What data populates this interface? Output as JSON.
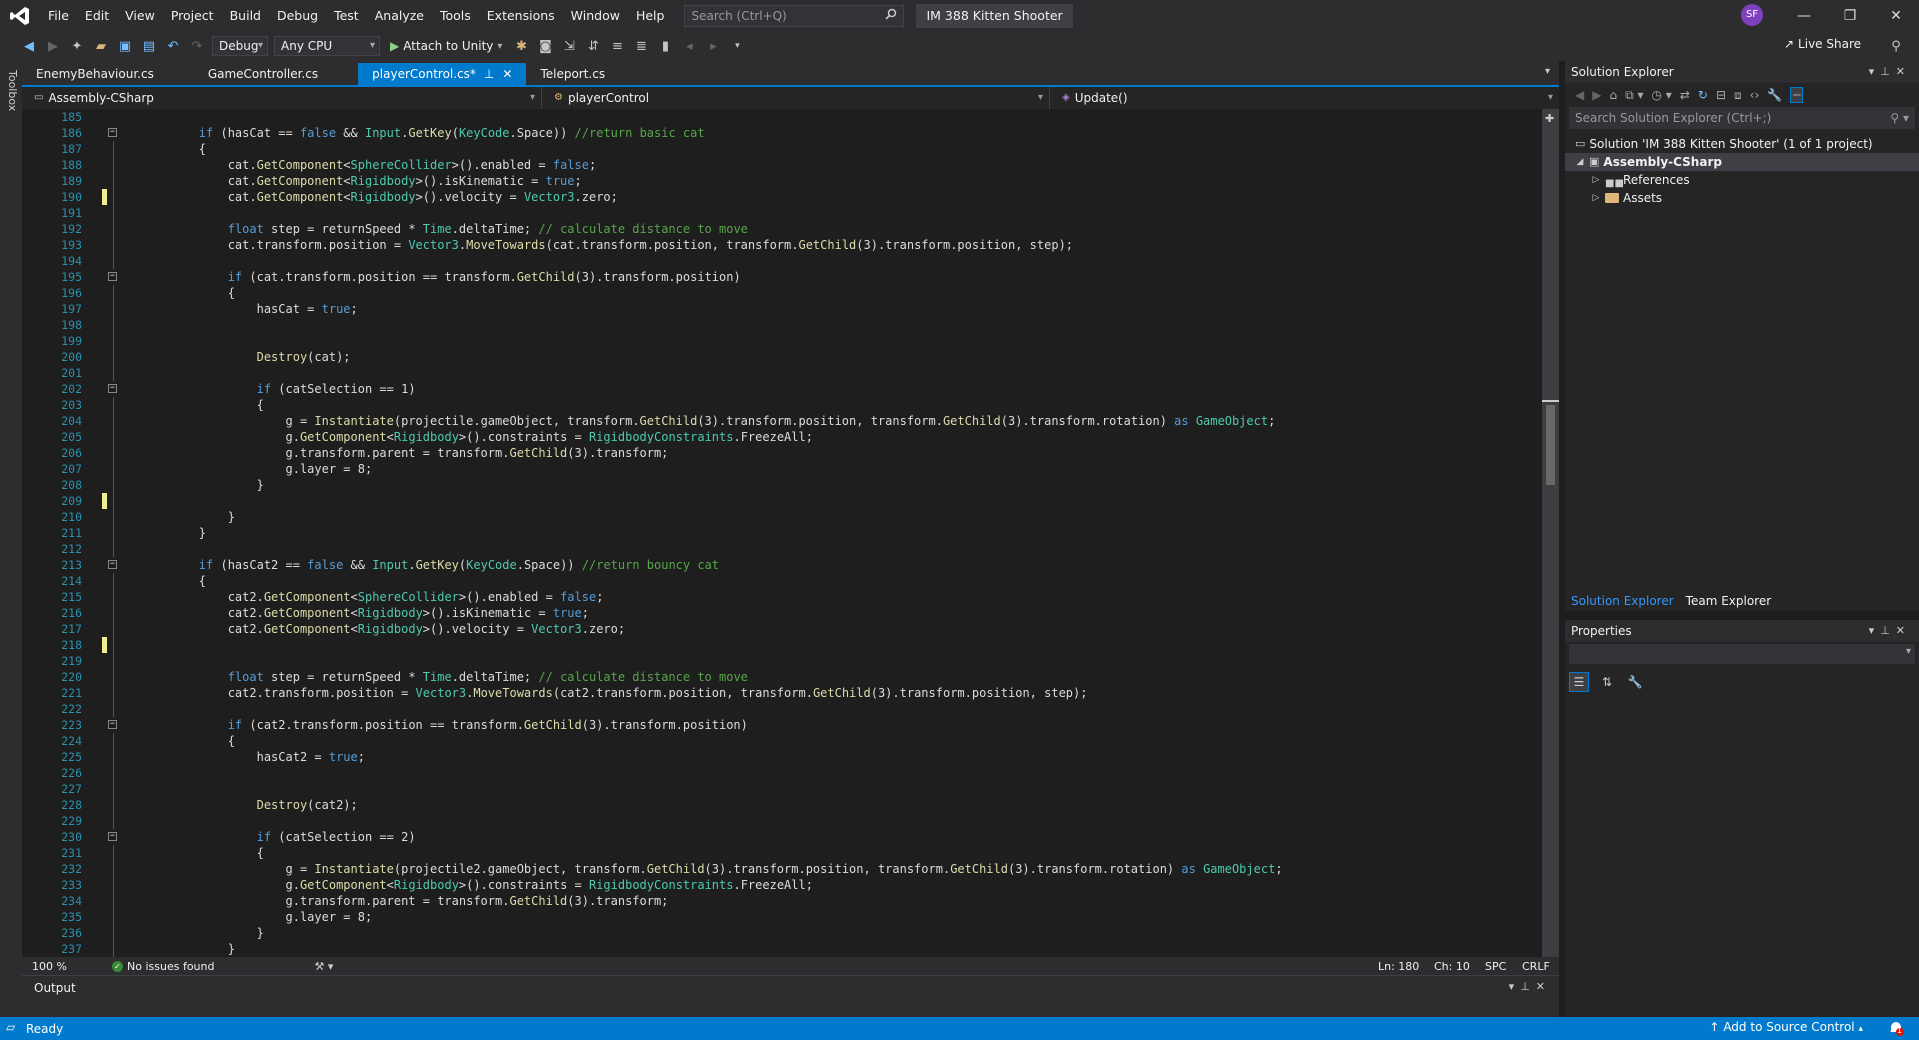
{
  "menu": {
    "items": [
      "File",
      "Edit",
      "View",
      "Project",
      "Build",
      "Debug",
      "Test",
      "Analyze",
      "Tools",
      "Extensions",
      "Window",
      "Help"
    ],
    "search_placeholder": "Search (Ctrl+Q)",
    "solution_title": "IM 388 Kitten Shooter",
    "user_initials": "SF"
  },
  "toolbar": {
    "configuration": "Debug",
    "platform": "Any CPU",
    "attach_label": "Attach to Unity",
    "live_share": "Live Share"
  },
  "toolbox_label": "Toolbox",
  "tabs": [
    {
      "label": "EnemyBehaviour.cs",
      "active": false
    },
    {
      "label": "GameController.cs",
      "active": false
    },
    {
      "label": "playerControl.cs*",
      "active": true
    },
    {
      "label": "Teleport.cs",
      "active": false
    }
  ],
  "navbar": {
    "project": "Assembly-CSharp",
    "class": "playerControl",
    "member": "Update()"
  },
  "code": [
    {
      "n": "185",
      "t": "",
      "f": "",
      "c": false
    },
    {
      "n": "186",
      "t": "        <kw>if</kw> (hasCat == <kw>false</kw> && <ty>Input</ty>.<fn>GetKey</fn>(<ty>KeyCode</ty>.Space)) <cm>//return basic cat</cm>",
      "f": "-",
      "c": false
    },
    {
      "n": "187",
      "t": "        {",
      "f": "|",
      "c": false
    },
    {
      "n": "188",
      "t": "            cat.<fn>GetComponent</fn><<ty>SphereCollider</ty>>().enabled = <kw>false</kw>;",
      "f": "|",
      "c": false
    },
    {
      "n": "189",
      "t": "            cat.<fn>GetComponent</fn><<ty>Rigidbody</ty>>().isKinematic = <kw>true</kw>;",
      "f": "|",
      "c": false
    },
    {
      "n": "190",
      "t": "            cat.<fn>GetComponent</fn><<ty>Rigidbody</ty>>().velocity = <ty>Vector3</ty>.zero;",
      "f": "|",
      "c": true
    },
    {
      "n": "191",
      "t": "",
      "f": "|",
      "c": false
    },
    {
      "n": "192",
      "t": "            <kw>float</kw> step = returnSpeed * <ty>Time</ty>.deltaTime; <cm>// calculate distance to move</cm>",
      "f": "|",
      "c": false
    },
    {
      "n": "193",
      "t": "            cat.transform.position = <ty>Vector3</ty>.<fn>MoveTowards</fn>(cat.transform.position, transform.<fn>GetChild</fn>(3).transform.position, step);",
      "f": "|",
      "c": false
    },
    {
      "n": "194",
      "t": "",
      "f": "|",
      "c": false
    },
    {
      "n": "195",
      "t": "            <kw>if</kw> (cat.transform.position == transform.<fn>GetChild</fn>(3).transform.position)",
      "f": "-",
      "c": false
    },
    {
      "n": "196",
      "t": "            {",
      "f": "|",
      "c": false
    },
    {
      "n": "197",
      "t": "                hasCat = <kw>true</kw>;",
      "f": "|",
      "c": false
    },
    {
      "n": "198",
      "t": "",
      "f": "|",
      "c": false
    },
    {
      "n": "199",
      "t": "",
      "f": "|",
      "c": false
    },
    {
      "n": "200",
      "t": "                <fn>Destroy</fn>(cat);",
      "f": "|",
      "c": false
    },
    {
      "n": "201",
      "t": "",
      "f": "|",
      "c": false
    },
    {
      "n": "202",
      "t": "                <kw>if</kw> (catSelection == 1)",
      "f": "-",
      "c": false
    },
    {
      "n": "203",
      "t": "                {",
      "f": "|",
      "c": false
    },
    {
      "n": "204",
      "t": "                    g = <fn>Instantiate</fn>(projectile.gameObject, transform.<fn>GetChild</fn>(3).transform.position, transform.<fn>GetChild</fn>(3).transform.rotation) <kw>as</kw> <ty>GameObject</ty>;",
      "f": "|",
      "c": false
    },
    {
      "n": "205",
      "t": "                    g.<fn>GetComponent</fn><<ty>Rigidbody</ty>>().constraints = <ty>RigidbodyConstraints</ty>.FreezeAll;",
      "f": "|",
      "c": false
    },
    {
      "n": "206",
      "t": "                    g.transform.parent = transform.<fn>GetChild</fn>(3).transform;",
      "f": "|",
      "c": false
    },
    {
      "n": "207",
      "t": "                    g.layer = 8;",
      "f": "|",
      "c": false
    },
    {
      "n": "208",
      "t": "                }",
      "f": "|",
      "c": false
    },
    {
      "n": "209",
      "t": "",
      "f": "|",
      "c": true
    },
    {
      "n": "210",
      "t": "            }",
      "f": "|",
      "c": false
    },
    {
      "n": "211",
      "t": "        }",
      "f": "|",
      "c": false
    },
    {
      "n": "212",
      "t": "",
      "f": "|",
      "c": false
    },
    {
      "n": "213",
      "t": "        <kw>if</kw> (hasCat2 == <kw>false</kw> && <ty>Input</ty>.<fn>GetKey</fn>(<ty>KeyCode</ty>.Space)) <cm>//return bouncy cat</cm>",
      "f": "-",
      "c": false
    },
    {
      "n": "214",
      "t": "        {",
      "f": "|",
      "c": false
    },
    {
      "n": "215",
      "t": "            cat2.<fn>GetComponent</fn><<ty>SphereCollider</ty>>().enabled = <kw>false</kw>;",
      "f": "|",
      "c": false
    },
    {
      "n": "216",
      "t": "            cat2.<fn>GetComponent</fn><<ty>Rigidbody</ty>>().isKinematic = <kw>true</kw>;",
      "f": "|",
      "c": false
    },
    {
      "n": "217",
      "t": "            cat2.<fn>GetComponent</fn><<ty>Rigidbody</ty>>().velocity = <ty>Vector3</ty>.zero;",
      "f": "|",
      "c": false
    },
    {
      "n": "218",
      "t": "",
      "f": "|",
      "c": true
    },
    {
      "n": "219",
      "t": "",
      "f": "|",
      "c": false
    },
    {
      "n": "220",
      "t": "            <kw>float</kw> step = returnSpeed * <ty>Time</ty>.deltaTime; <cm>// calculate distance to move</cm>",
      "f": "|",
      "c": false
    },
    {
      "n": "221",
      "t": "            cat2.transform.position = <ty>Vector3</ty>.<fn>MoveTowards</fn>(cat2.transform.position, transform.<fn>GetChild</fn>(3).transform.position, step);",
      "f": "|",
      "c": false
    },
    {
      "n": "222",
      "t": "",
      "f": "|",
      "c": false
    },
    {
      "n": "223",
      "t": "            <kw>if</kw> (cat2.transform.position == transform.<fn>GetChild</fn>(3).transform.position)",
      "f": "-",
      "c": false
    },
    {
      "n": "224",
      "t": "            {",
      "f": "|",
      "c": false
    },
    {
      "n": "225",
      "t": "                hasCat2 = <kw>true</kw>;",
      "f": "|",
      "c": false
    },
    {
      "n": "226",
      "t": "",
      "f": "|",
      "c": false
    },
    {
      "n": "227",
      "t": "",
      "f": "|",
      "c": false
    },
    {
      "n": "228",
      "t": "                <fn>Destroy</fn>(cat2);",
      "f": "|",
      "c": false
    },
    {
      "n": "229",
      "t": "",
      "f": "|",
      "c": false
    },
    {
      "n": "230",
      "t": "                <kw>if</kw> (catSelection == 2)",
      "f": "-",
      "c": false
    },
    {
      "n": "231",
      "t": "                {",
      "f": "|",
      "c": false
    },
    {
      "n": "232",
      "t": "                    g = <fn>Instantiate</fn>(projectile2.gameObject, transform.<fn>GetChild</fn>(3).transform.position, transform.<fn>GetChild</fn>(3).transform.rotation) <kw>as</kw> <ty>GameObject</ty>;",
      "f": "|",
      "c": false
    },
    {
      "n": "233",
      "t": "                    g.<fn>GetComponent</fn><<ty>Rigidbody</ty>>().constraints = <ty>RigidbodyConstraints</ty>.FreezeAll;",
      "f": "|",
      "c": false
    },
    {
      "n": "234",
      "t": "                    g.transform.parent = transform.<fn>GetChild</fn>(3).transform;",
      "f": "|",
      "c": false
    },
    {
      "n": "235",
      "t": "                    g.layer = 8;",
      "f": "|",
      "c": false
    },
    {
      "n": "236",
      "t": "                }",
      "f": "|",
      "c": false
    },
    {
      "n": "237",
      "t": "            }",
      "f": "|",
      "c": false
    }
  ],
  "editor_status": {
    "zoom": "100 %",
    "issues": "No issues found",
    "line": "Ln: 180",
    "col": "Ch: 10",
    "indent": "SPC",
    "eol": "CRLF"
  },
  "output": {
    "title": "Output"
  },
  "solution_explorer": {
    "title": "Solution Explorer",
    "search_placeholder": "Search Solution Explorer (Ctrl+;)",
    "solution": "Solution 'IM 388 Kitten Shooter' (1 of 1 project)",
    "project": "Assembly-CSharp",
    "references": "References",
    "assets": "Assets",
    "tab_solution": "Solution Explorer",
    "tab_team": "Team Explorer"
  },
  "properties": {
    "title": "Properties"
  },
  "statusbar": {
    "ready": "Ready",
    "source_control": "Add to Source Control",
    "notification_count": "1"
  },
  "colors": {
    "accent": "#007acc",
    "change_marker": "#efef91"
  }
}
